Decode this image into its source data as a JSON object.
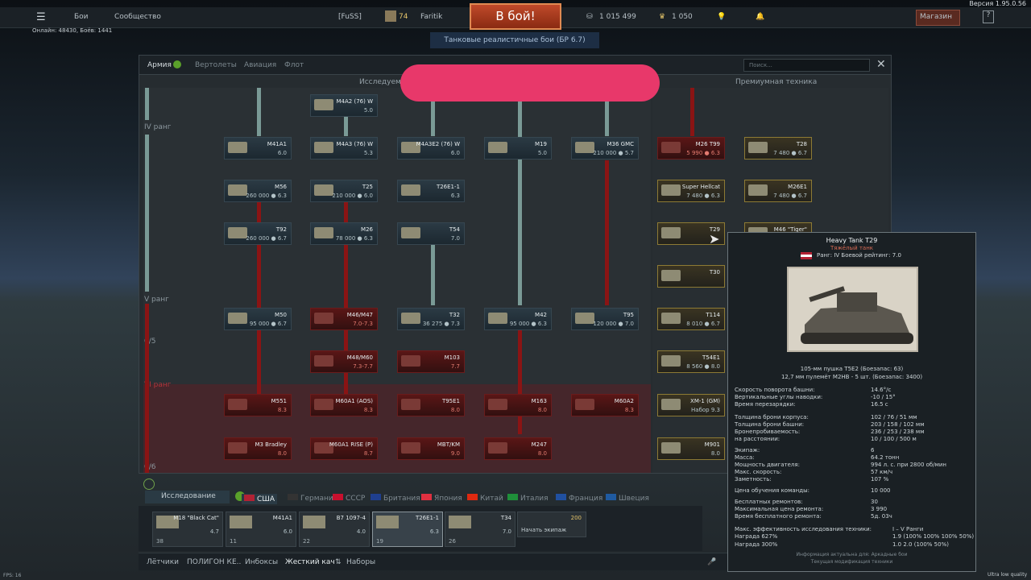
{
  "version": "Версия 1.95.0.56",
  "top": {
    "menu_icon": "hamburger-icon",
    "battles": "Бои",
    "community": "Сообщество",
    "clan_tag": "[FuSS]",
    "level": "74",
    "nickname": "Faritik",
    "battle_button": "В бой!",
    "silver": "1 015 499",
    "gold": "1 050",
    "shop": "Магазин",
    "help": "?",
    "online": "Онлайн: 48430, Боёв: 1441",
    "mode": "Танковые реалистичные бои (БР 6.7)"
  },
  "window": {
    "tabs": [
      "Армия",
      "Вертолеты",
      "Авиация",
      "Флот"
    ],
    "search_placeholder": "Поиск...",
    "researchable": "Исследуемая",
    "premium": "Премиумная техника",
    "rank_iv": "IV ранг",
    "rank_v": "V ранг",
    "rank_v_progress": "0/5",
    "rank_vi": "VI ранг",
    "rank_vi_progress": "0/6"
  },
  "tree": [
    {
      "name": "M4A2 (76) W",
      "br": "5.0",
      "red": false
    },
    {
      "name": "M41A1",
      "br": "6.0",
      "red": false
    },
    {
      "name": "M4A3 (76) W",
      "br": "5.3",
      "red": false
    },
    {
      "name": "M4A3E2 (76) W",
      "br": "6.0",
      "red": false
    },
    {
      "name": "M19",
      "br": "5.0",
      "red": false
    },
    {
      "name": "M36 GMC",
      "br": "210 000 ● 5.7",
      "red": false
    },
    {
      "name": "M56",
      "br": "260 000 ● 6.3",
      "red": false
    },
    {
      "name": "T25",
      "br": "210 000 ● 6.0",
      "red": false
    },
    {
      "name": "T26E1-1",
      "br": "6.3",
      "red": false
    },
    {
      "name": "T92",
      "br": "260 000 ● 6.7",
      "red": false
    },
    {
      "name": "M26",
      "br": "78 000 ● 6.3",
      "red": false
    },
    {
      "name": "T54",
      "br": "7.0",
      "red": false
    },
    {
      "name": "M50",
      "br": "95 000 ● 6.7",
      "red": false
    },
    {
      "name": "M46/M47",
      "br": "7.0-7.3",
      "red": true
    },
    {
      "name": "T32",
      "br": "36 275 ● 7.3",
      "red": false
    },
    {
      "name": "M42",
      "br": "95 000 ● 6.3",
      "red": false
    },
    {
      "name": "T95",
      "br": "120 000 ● 7.0",
      "red": false
    },
    {
      "name": "M48/M60",
      "br": "7.3-7.7",
      "red": true
    },
    {
      "name": "M103",
      "br": "7.7",
      "red": true
    },
    {
      "name": "M551",
      "br": "8.3",
      "red": true
    },
    {
      "name": "M60A1 (AOS)",
      "br": "8.3",
      "red": true
    },
    {
      "name": "T95E1",
      "br": "8.0",
      "red": true
    },
    {
      "name": "M163",
      "br": "8.0",
      "red": true
    },
    {
      "name": "M60A2",
      "br": "8.3",
      "red": true
    },
    {
      "name": "M3 Bradley",
      "br": "8.0",
      "red": true
    },
    {
      "name": "M60A1 RISE (P)",
      "br": "8.7",
      "red": true
    },
    {
      "name": "MBT/KM",
      "br": "9.0",
      "red": true
    },
    {
      "name": "M247",
      "br": "8.0",
      "red": true
    }
  ],
  "premium": [
    {
      "name": "M26 T99",
      "br": "5 990 ● 6.3"
    },
    {
      "name": "T28",
      "br": "7 480 ● 6.7"
    },
    {
      "name": "Super Hellcat",
      "br": "7 480 ● 6.3"
    },
    {
      "name": "M26E1",
      "br": "7 480 ● 6.7"
    },
    {
      "name": "T29",
      "br": ""
    },
    {
      "name": "M46 \"Tiger\"",
      "br": ""
    },
    {
      "name": "T30",
      "br": ""
    },
    {
      "name": "T114",
      "br": "8 010 ● 6.7"
    },
    {
      "name": "T54E1",
      "br": "8 560 ● 8.0"
    },
    {
      "name": "XM-1 (GM)",
      "br": "Набор 9.3"
    },
    {
      "name": "M901",
      "br": "8.0"
    }
  ],
  "nations": {
    "research": "Исследование",
    "list": [
      "США",
      "Германия",
      "СССР",
      "Британия",
      "Япония",
      "Китай",
      "Италия",
      "Франция",
      "Швеция"
    ]
  },
  "crew": [
    {
      "name": "M18 \"Black Cat\"",
      "br": "4.7",
      "count": "38"
    },
    {
      "name": "M41A1",
      "br": "6.0",
      "count": "11"
    },
    {
      "name": "B7 1097-4",
      "br": "4.0",
      "count": "22"
    },
    {
      "name": "T26E1-1",
      "br": "6.3",
      "count": "19"
    },
    {
      "name": "T34",
      "br": "7.0",
      "count": "26"
    }
  ],
  "crew_extra": {
    "price": "200",
    "label": "Начать экипаж"
  },
  "footer": {
    "tabs": [
      "Лётчики",
      "ПОЛИГОН КЕ..",
      "Инбоксы",
      "Жесткий кач",
      "Наборы"
    ],
    "fps": "FPS: 16",
    "quality": "Ultra low quality"
  },
  "tooltip": {
    "title": "Heavy Tank T29",
    "subtitle": "Тяжёлый танк",
    "rank": "Ранг: IV   Боевой рейтинг: 7.0",
    "gun1": "105-мм пушка T5E2 (Боезапас: 63)",
    "gun2": "12,7 мм пулемёт M2HB - 5 шт. (Боезапас: 3400)",
    "rows": [
      [
        "Скорость поворота башни:",
        "14.6°/с"
      ],
      [
        "Вертикальные углы наводки:",
        "-10 / 15°"
      ],
      [
        "Время перезарядки:",
        "16.5 с"
      ],
      [
        "Толщина брони корпуса:",
        "102 / 76 / 51 мм"
      ],
      [
        "Толщина брони башни:",
        "203 / 158 / 102 мм"
      ],
      [
        "Бронепробиваемость:",
        "236 / 253 / 238 мм"
      ],
      [
        "на расстоянии:",
        "10 / 100 / 500 м"
      ],
      [
        "Экипаж:",
        "6"
      ],
      [
        "Масса:",
        "64.2 тонн"
      ],
      [
        "Мощность двигателя:",
        "994 л. с. при 2800 об/мин"
      ],
      [
        "Макс. скорость:",
        "57 км/ч"
      ],
      [
        "Заметность:",
        "107 %"
      ],
      [
        "Цена обучения команды:",
        "10 000"
      ],
      [
        "Бесплатных ремонтов:",
        "30"
      ],
      [
        "Максимальная цена ремонта:",
        "3 990"
      ],
      [
        "Время бесплатного ремонта:",
        "5д. 03ч"
      ],
      [
        "Макс. эффективность исследования техники:",
        "I – V Ранги"
      ],
      [
        "Награда 627%",
        "1.9 (100% 100% 100% 50%)"
      ],
      [
        "Награда 300%",
        "1.0 2.0 (100% 50%)"
      ]
    ],
    "note1": "Информация актуальна для: Аркадные бои",
    "note2": "Текущая модификация техники"
  }
}
